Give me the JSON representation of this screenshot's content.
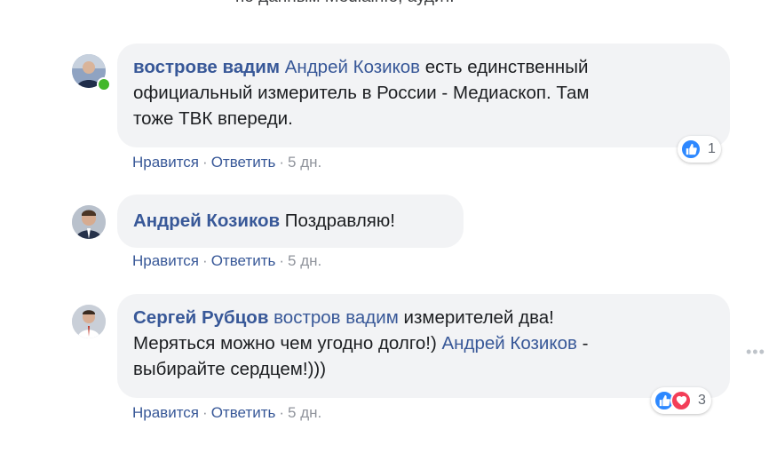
{
  "top_cut_text": "по данным Mediainfo, аудит.",
  "comments": [
    {
      "author": "вострове вадим",
      "mention": "Андрей Козиков",
      "text_line1": "есть единственный",
      "text_line2": "официальный измеритель в России - Медиаскоп. Там",
      "text_line3": "тоже ТВК впереди.",
      "like_label": "Нравится",
      "reply_label": "Ответить",
      "time": "5 дн.",
      "reaction_count": "1"
    },
    {
      "author": "Андрей Козиков",
      "text": "Поздравляю!",
      "like_label": "Нравится",
      "reply_label": "Ответить",
      "time": "5 дн."
    },
    {
      "author": "Сергей Рубцов",
      "mention": "востров вадим",
      "text_line1": "измерителей два!",
      "text_line2_pre": "Меряться можно чем угодно долго!)",
      "mention2": "Андрей Козиков",
      "text_line2_post": "-",
      "text_line3": "выбирайте сердцем!)))",
      "like_label": "Нравится",
      "reply_label": "Ответить",
      "time": "5 дн.",
      "reaction_count": "3"
    }
  ],
  "separator": "·",
  "more_icon": "•••",
  "colors": {
    "link": "#385898",
    "bubble": "#f2f3f5",
    "online": "#42b72a",
    "like": "#2d88ff",
    "love": "#f33e58"
  }
}
